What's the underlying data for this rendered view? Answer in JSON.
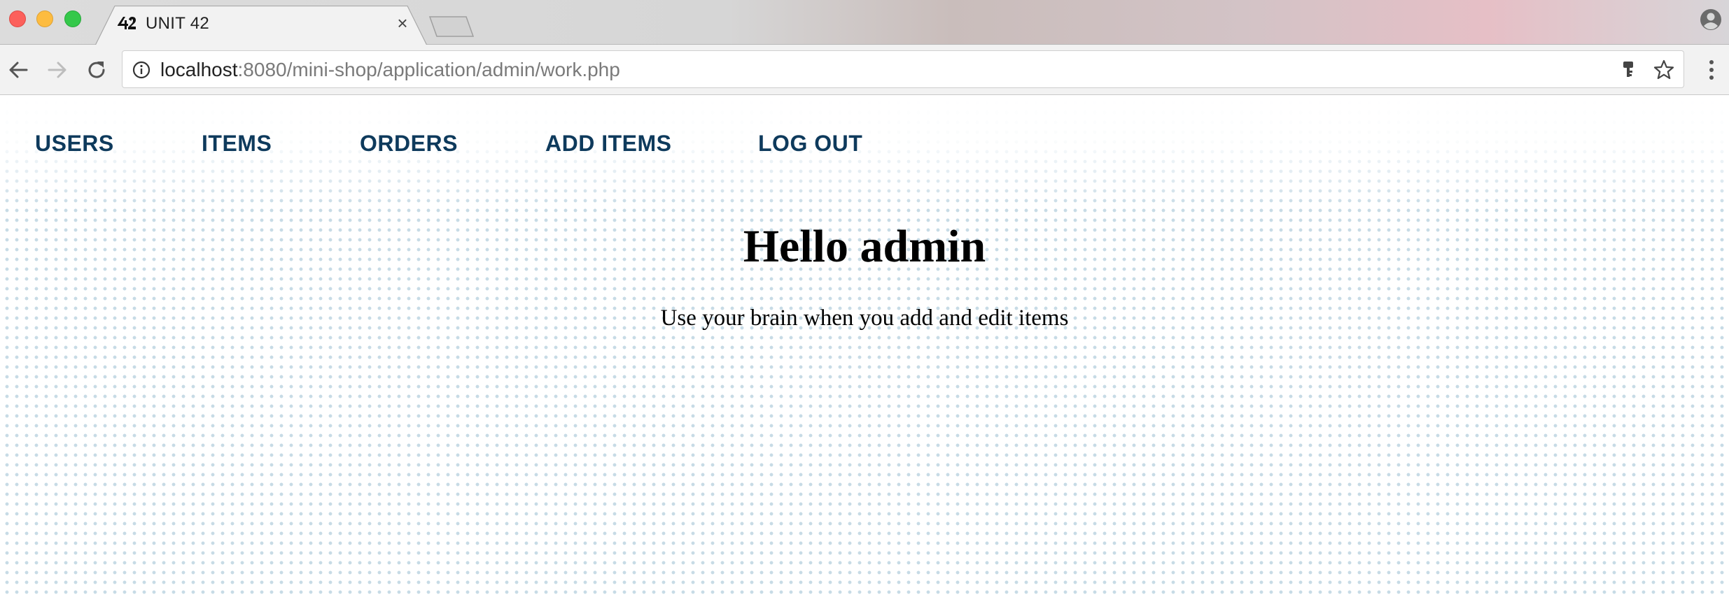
{
  "browser": {
    "tab": {
      "title": "UNIT 42",
      "close_glyph": "×",
      "favicon": "unit42-logo-icon"
    },
    "url": {
      "host": "localhost",
      "rest": ":8080/mini-shop/application/admin/work.php"
    },
    "icons": {
      "back": "arrow-left-icon",
      "forward": "arrow-right-icon",
      "reload": "reload-icon",
      "info": "info-icon",
      "key": "key-icon",
      "bookmark": "star-icon",
      "menu": "kebab-menu-icon",
      "profile": "profile-icon"
    }
  },
  "nav": {
    "items": [
      {
        "label": "USERS"
      },
      {
        "label": "ITEMS"
      },
      {
        "label": "ORDERS"
      },
      {
        "label": "ADD ITEMS"
      },
      {
        "label": "LOG OUT"
      }
    ],
    "color": "#0e3a5c"
  },
  "main": {
    "heading": "Hello admin",
    "subtext": "Use your brain when you add and edit items"
  }
}
